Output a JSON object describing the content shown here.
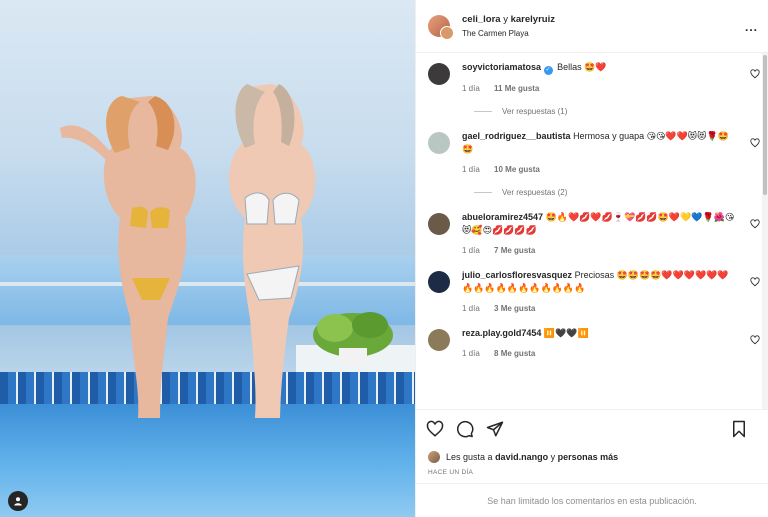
{
  "header": {
    "user_primary": "celi_lora",
    "conjunction": "y",
    "user_secondary": "karelyruiz",
    "location": "The Carmen Playa",
    "more_label": "..."
  },
  "comments": [
    {
      "username": "soyvictoriamatosa",
      "verified": true,
      "text": "Bellas 🤩❤️",
      "time": "1 día",
      "likes": "11 Me gusta",
      "replies": "Ver respuestas (1)",
      "avatar_color": "#3c3a3a"
    },
    {
      "username": "gael_rodriguez__bautista",
      "verified": false,
      "text": "Hermosa y guapa 😘😘❤️❤️😻😻🌹🤩🤩",
      "time": "1 día",
      "likes": "10 Me gusta",
      "replies": "Ver respuestas (2)",
      "avatar_color": "#b9c7c2"
    },
    {
      "username": "abueloramirez4547",
      "verified": false,
      "text": "🤩🔥❤️💋❤️💋🍷💝💋💋🤩❤️💛💙🌹🌺😘😻🥰😍💋💋💋💋",
      "time": "1 día",
      "likes": "7 Me gusta",
      "replies": "",
      "avatar_color": "#6a5a47"
    },
    {
      "username": "julio_carlosfloresvasquez",
      "verified": false,
      "text": "Preciosas 🤩🤩🤩🤩❤️❤️❤️❤️❤️❤️🔥🔥🔥🔥🔥🔥🔥🔥🔥🔥🔥",
      "time": "1 día",
      "likes": "3 Me gusta",
      "replies": "",
      "avatar_color": "#1e2b45"
    },
    {
      "username": "reza.play.gold7454",
      "verified": false,
      "text": "⏸️🖤🖤⏸️",
      "time": "1 día",
      "likes": "8 Me gusta",
      "replies": "",
      "avatar_color": "#8c7b5a"
    }
  ],
  "likes": {
    "prefix": "Les gusta a",
    "user": "david.nango",
    "suffix_and": "y",
    "suffix_more": "personas más"
  },
  "date_label": "HACE UN DÍA",
  "limited_comments": "Se han limitado los comentarios en esta publicación.",
  "icons": {
    "like": "heart-icon",
    "comment": "comment-icon",
    "share": "send-icon",
    "save": "bookmark-icon",
    "more": "more-icon",
    "tag": "user-tag-icon"
  }
}
